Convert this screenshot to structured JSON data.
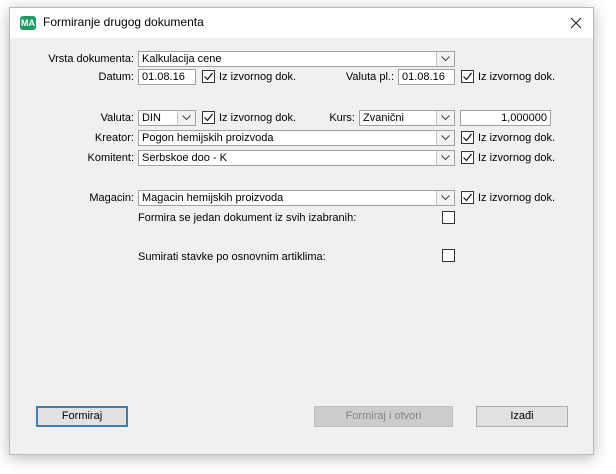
{
  "window": {
    "title": "Formiranje drugog dokumenta",
    "app_icon_text": "MA"
  },
  "form": {
    "vrsta_label": "Vrsta dokumenta:",
    "vrsta_value": "Kalkulacija cene",
    "datum_label": "Datum:",
    "datum_value": "01.08.16",
    "datum_chk_label": "Iz izvornog dok.",
    "valuta_pl_label": "Valuta pl.:",
    "valuta_pl_value": "01.08.16",
    "valuta_pl_chk_label": "Iz izvornog dok.",
    "valuta_label": "Valuta:",
    "valuta_value": "DIN",
    "valuta_chk_label": "Iz izvornog dok.",
    "kurs_label": "Kurs:",
    "kurs_type": "Zvanični",
    "kurs_value": "1,000000",
    "kreator_label": "Kreator:",
    "kreator_value": "Pogon hemijskih proizvoda",
    "kreator_chk_label": "Iz izvornog dok.",
    "komitent_label": "Komitent:",
    "komitent_value": "Serbskoe doo - K",
    "komitent_chk_label": "Iz izvornog dok.",
    "magacin_label": "Magacin:",
    "magacin_value": "Magacin hemijskih proizvoda",
    "magacin_chk_label": "Iz izvornog dok.",
    "jedan_dokument_label": "Formira se jedan dokument iz svih izabranih:",
    "sumirati_label": "Sumirati stavke po osnovnim artiklima:"
  },
  "checkboxes": {
    "datum": true,
    "valuta_pl": true,
    "valuta": true,
    "kreator": true,
    "komitent": true,
    "magacin": true,
    "jedan_dokument": false,
    "sumirati": false
  },
  "buttons": {
    "formiraj": "Formiraj",
    "formiraj_otvori": "Formiraj i otvori",
    "izadji": "Izađi"
  },
  "colors": {
    "icon_green": "#1e9c63",
    "default_button_border": "#3c7fb1",
    "disabled_text": "#838383"
  }
}
